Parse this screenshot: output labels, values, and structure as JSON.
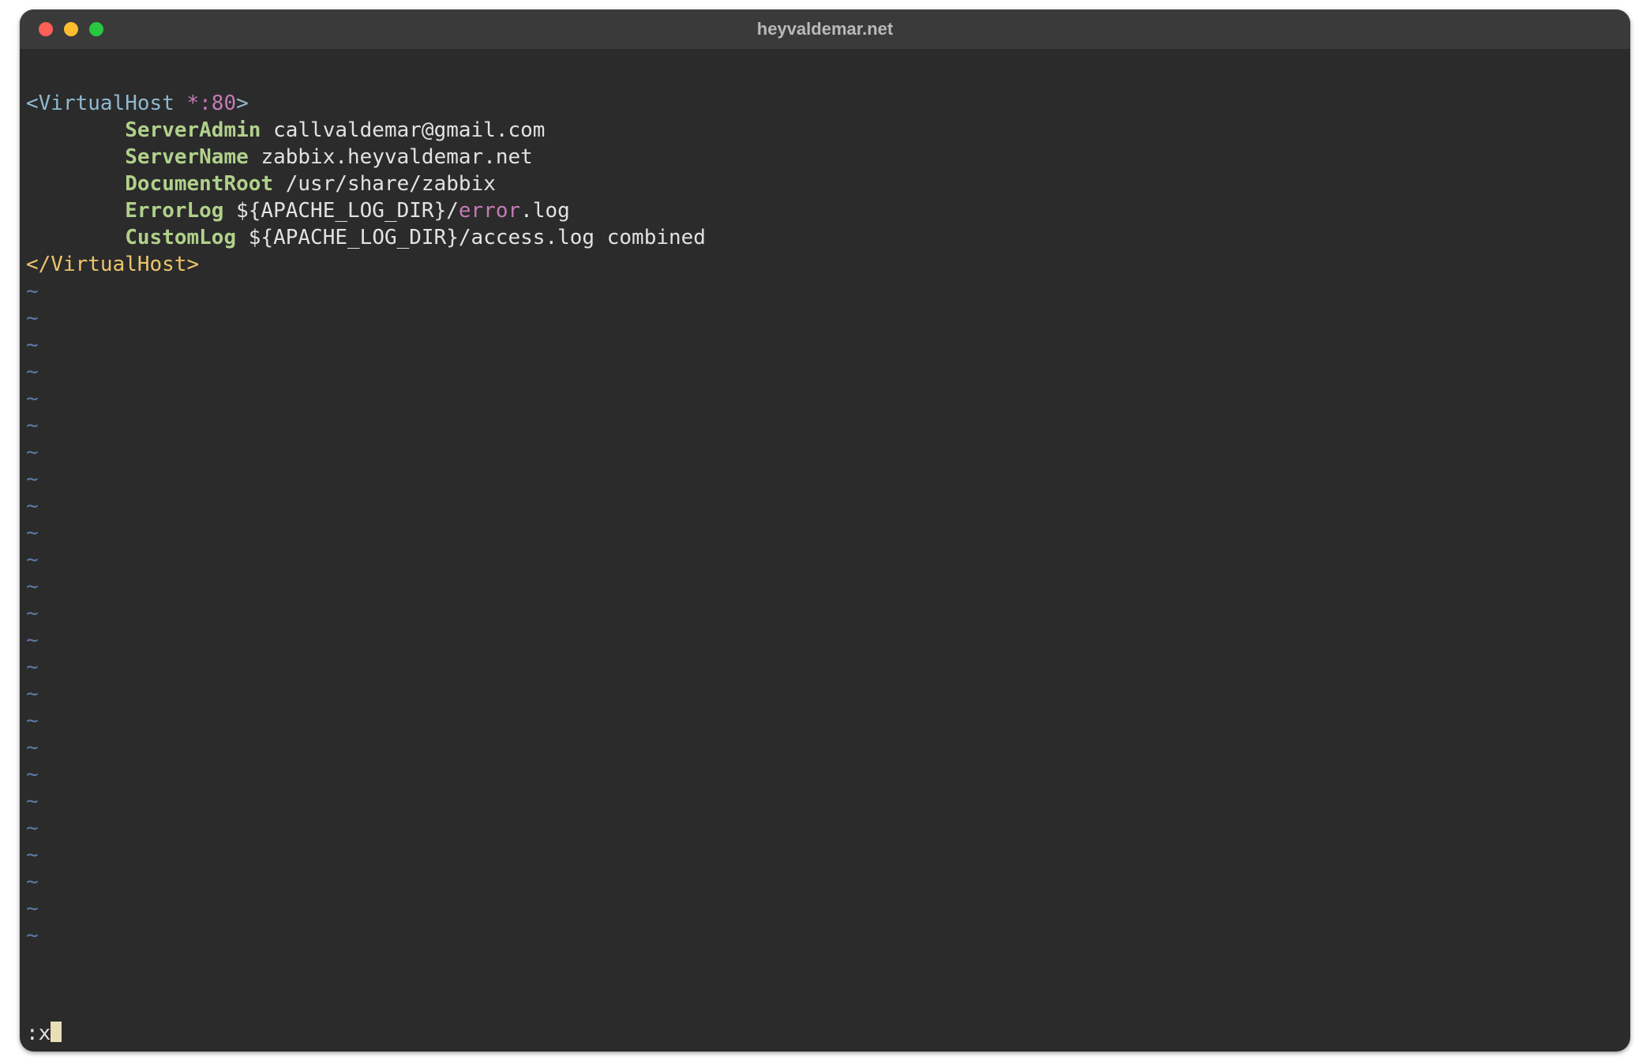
{
  "window": {
    "title": "heyvaldemar.net",
    "traffic": {
      "close": "#ff5f57",
      "min": "#febc2e",
      "max": "#28c840"
    }
  },
  "code": {
    "l1": {
      "open": "<",
      "tag": "VirtualHost",
      "space": " ",
      "star": "*:80",
      "close": ">"
    },
    "l2": {
      "indent": "        ",
      "key": "ServerAdmin",
      "space": " ",
      "val": "callvaldemar@gmail.com"
    },
    "l3": {
      "indent": "        ",
      "key": "ServerName",
      "space": " ",
      "val": "zabbix.heyvaldemar.net"
    },
    "l4": {
      "indent": "        ",
      "key": "DocumentRoot",
      "space": " ",
      "val": "/usr/share/zabbix"
    },
    "l5": {
      "indent": "        ",
      "key": "ErrorLog",
      "space": " ",
      "var": "${APACHE_LOG_DIR}",
      "slash": "/",
      "err": "error",
      "rest": ".log"
    },
    "l6": {
      "indent": "        ",
      "key": "CustomLog",
      "space": " ",
      "var": "${APACHE_LOG_DIR}",
      "rest": "/access.log combined"
    },
    "l7": {
      "text": "</VirtualHost>"
    }
  },
  "editor": {
    "tilde": "~",
    "tilde_rows": 25,
    "command_prefix": ":",
    "command": "x"
  }
}
